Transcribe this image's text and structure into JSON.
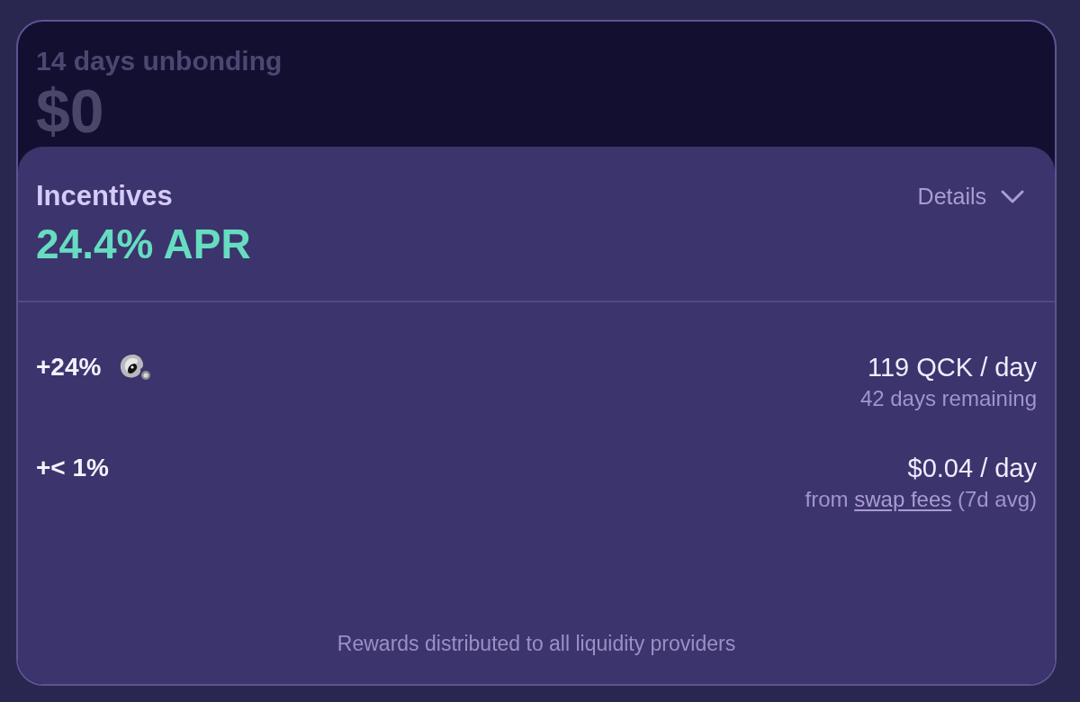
{
  "card": {
    "title": "14 days unbonding",
    "amount": "$0"
  },
  "incentives": {
    "title": "Incentives",
    "apr": "24.4% APR",
    "details": "Details"
  },
  "rows": [
    {
      "kind": "token",
      "percent": "+24%",
      "rate": "119 QCK / day",
      "note": "42 days remaining"
    },
    {
      "kind": "fees",
      "percent": "+< 1%",
      "rate": "$0.04 / day",
      "note": "from",
      "link": "swap fees",
      "note_end": "(7d avg)"
    }
  ],
  "footer": "Rewards distributed to all liquidity providers"
}
